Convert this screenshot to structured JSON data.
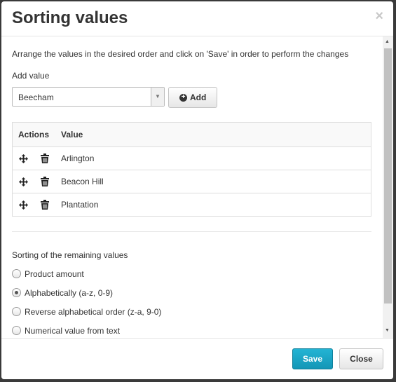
{
  "dialog": {
    "title": "Sorting values",
    "close_symbol": "×",
    "intro_text": "Arrange the values in the desired order and click on 'Save' in order to perform the changes",
    "add_value_label": "Add value",
    "select": {
      "selected": "Beecham",
      "arrow": "▼"
    },
    "add_button": {
      "label": "Add",
      "icon": "plus-circle-icon",
      "icon_glyph": "+"
    },
    "table": {
      "headers": {
        "actions": "Actions",
        "value": "Value"
      },
      "rows": [
        {
          "value": "Arlington"
        },
        {
          "value": "Beacon Hill"
        },
        {
          "value": "Plantation"
        }
      ]
    },
    "sorting_label": "Sorting of the remaining values",
    "sorting_options": [
      {
        "label": "Product amount",
        "checked": false
      },
      {
        "label": "Alphabetically (a-z, 0-9)",
        "checked": true
      },
      {
        "label": "Reverse alphabetical order (z-a, 9-0)",
        "checked": false
      },
      {
        "label": "Numerical value from text",
        "checked": false
      }
    ],
    "scrollbar": {
      "up": "▲",
      "down": "▼"
    },
    "footer": {
      "save_label": "Save",
      "close_label": "Close"
    }
  },
  "colors": {
    "primary": "#1aa6c6",
    "border": "#dddddd"
  }
}
